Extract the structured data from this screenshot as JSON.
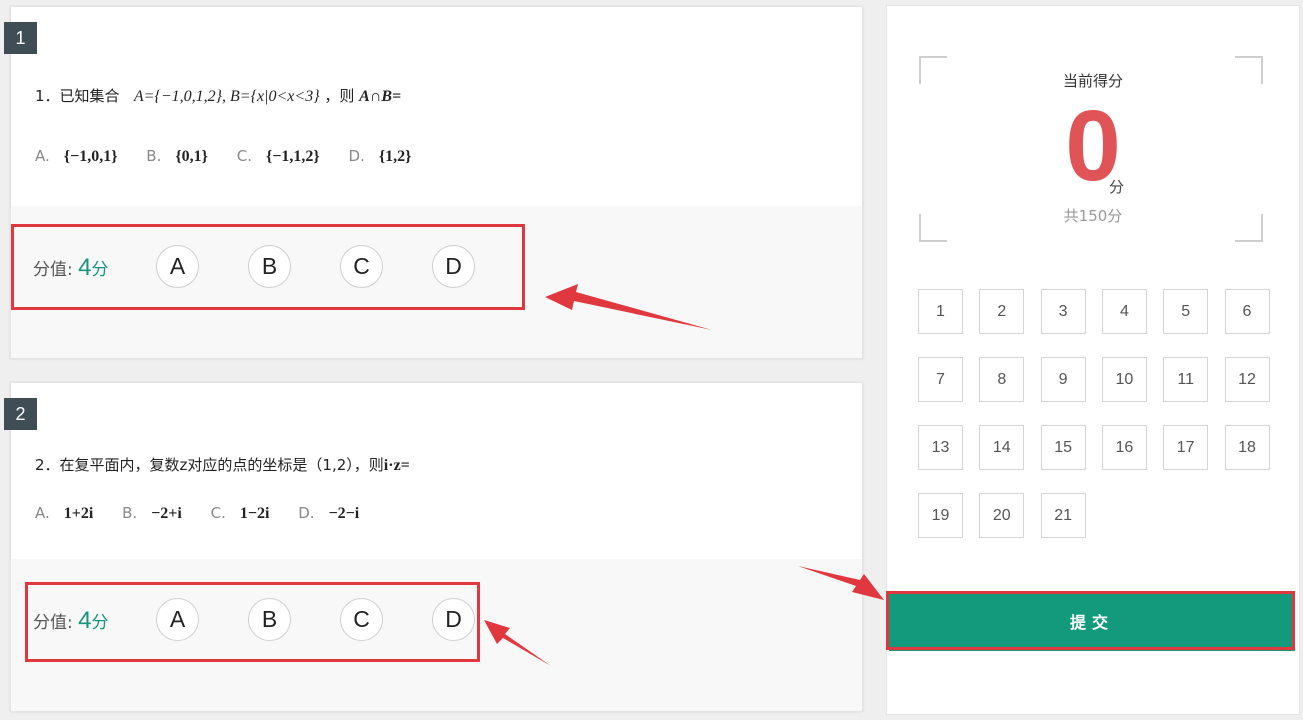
{
  "questions": [
    {
      "badge": "1",
      "stem_prefix": "1．已知集合",
      "stem_math": "A={−1,0,1,2}, B={x|0<x<3}",
      "stem_suffix": "，则",
      "stem_math2": "A∩B=",
      "options": [
        {
          "letter": "A.",
          "value": "{−1,0,1}"
        },
        {
          "letter": "B.",
          "value": "{0,1}"
        },
        {
          "letter": "C.",
          "value": "{−1,1,2}"
        },
        {
          "letter": "D.",
          "value": "{1,2}"
        }
      ],
      "score_label": "分值:",
      "score_value": "4",
      "score_unit": "分",
      "choices": [
        "A",
        "B",
        "C",
        "D"
      ]
    },
    {
      "badge": "2",
      "stem_prefix": "2．在复平面内，复数z对应的点的坐标是（1,2），则",
      "stem_math2": "i·z=",
      "options": [
        {
          "letter": "A.",
          "value": "1+2i"
        },
        {
          "letter": "B.",
          "value": "−2+i"
        },
        {
          "letter": "C.",
          "value": "1−2i"
        },
        {
          "letter": "D.",
          "value": "−2−i"
        }
      ],
      "score_label": "分值:",
      "score_value": "4",
      "score_unit": "分",
      "choices": [
        "A",
        "B",
        "C",
        "D"
      ]
    }
  ],
  "side": {
    "title": "当前得分",
    "score": "0",
    "unit": "分",
    "total": "共150分",
    "nav": [
      "1",
      "2",
      "3",
      "4",
      "5",
      "6",
      "7",
      "8",
      "9",
      "10",
      "11",
      "12",
      "13",
      "14",
      "15",
      "16",
      "17",
      "18",
      "19",
      "20",
      "21"
    ],
    "submit_label": "提交"
  },
  "colors": {
    "accent": "#139a7c",
    "score_red": "#e05457",
    "annotation_red": "#e0383e",
    "badge_bg": "#3f4d55"
  }
}
